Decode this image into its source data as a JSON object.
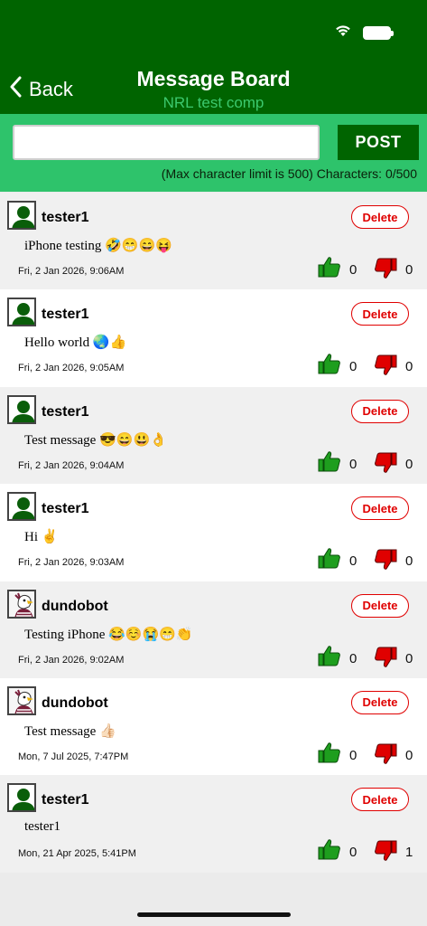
{
  "header": {
    "back_label": "Back",
    "title": "Message Board",
    "subtitle": "NRL test comp",
    "background_color": "#006400",
    "subtitle_color": "#3cc96e"
  },
  "composer": {
    "input_value": "",
    "post_label": "POST",
    "char_limit_text": "(Max character limit is 500) Characters: 0/500",
    "background_color": "#2ec36b"
  },
  "messages": [
    {
      "avatar": "user-silhouette-icon",
      "username": "tester1",
      "text": "iPhone testing 🤣😁😄😝",
      "timestamp": "Fri, 2 Jan 2026, 9:06AM",
      "likes": "0",
      "dislikes": "0",
      "delete_label": "Delete"
    },
    {
      "avatar": "user-silhouette-icon",
      "username": "tester1",
      "text": "Hello world 🌏👍",
      "timestamp": "Fri, 2 Jan 2026, 9:05AM",
      "likes": "0",
      "dislikes": "0",
      "delete_label": "Delete"
    },
    {
      "avatar": "user-silhouette-icon",
      "username": "tester1",
      "text": "Test message 😎😄😃👌",
      "timestamp": "Fri, 2 Jan 2026, 9:04AM",
      "likes": "0",
      "dislikes": "0",
      "delete_label": "Delete"
    },
    {
      "avatar": "user-silhouette-icon",
      "username": "tester1",
      "text": "Hi ✌️",
      "timestamp": "Fri, 2 Jan 2026, 9:03AM",
      "likes": "0",
      "dislikes": "0",
      "delete_label": "Delete"
    },
    {
      "avatar": "eagle-mascot-icon",
      "username": "dundobot",
      "text": "Testing iPhone 😂☺️😭😁👏",
      "timestamp": "Fri, 2 Jan 2026, 9:02AM",
      "likes": "0",
      "dislikes": "0",
      "delete_label": "Delete"
    },
    {
      "avatar": "eagle-mascot-icon",
      "username": "dundobot",
      "text": "Test message 👍🏻",
      "timestamp": "Mon, 7 Jul 2025, 7:47PM",
      "likes": "0",
      "dislikes": "0",
      "delete_label": "Delete"
    },
    {
      "avatar": "user-silhouette-icon",
      "username": "tester1",
      "text": "tester1",
      "timestamp": "Mon, 21 Apr 2025, 5:41PM",
      "likes": "0",
      "dislikes": "1",
      "delete_label": "Delete"
    }
  ],
  "colors": {
    "like": "#1e9e1e",
    "dislike": "#e00000",
    "delete": "#e00000"
  }
}
